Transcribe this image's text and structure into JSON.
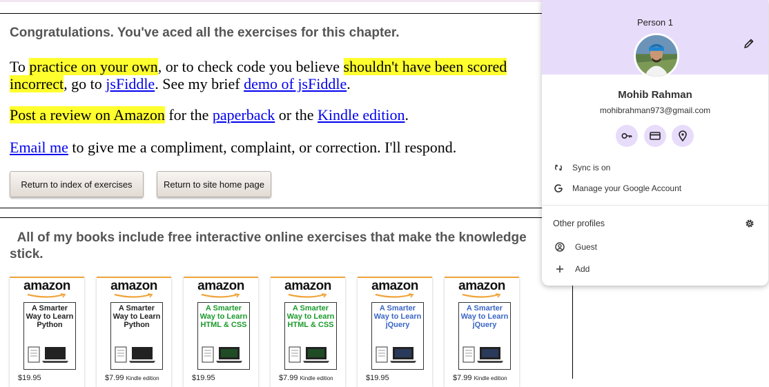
{
  "page": {
    "congrats": "Congratulations. You've aced all the exercises for this chapter.",
    "p1": {
      "t1": "To ",
      "h1": "practice on your own",
      "t2": ", or to check code you believe ",
      "h2a": "shouldn't have been scored",
      "h2b": "incorrect",
      "t3": ", go to ",
      "link_jsfiddle": "jsFiddle",
      "t4": ". See my brief ",
      "link_demo": "demo of jsFiddle",
      "t5": "."
    },
    "p2": {
      "h1": "Post a review on Amazon",
      "t1": " for the ",
      "link_paperback": "paperback",
      "t2": " or the ",
      "link_kindle": "Kindle edition",
      "t3": "."
    },
    "p3": {
      "link_email": "Email me",
      "t1": " to give me a compliment, complaint, or correction. I'll respond."
    },
    "buttons": {
      "return_index": "Return to index of exercises",
      "return_home": "Return to site home page"
    },
    "books_heading": "All of my books include free interactive online exercises that make the knowledge stick.",
    "books": [
      {
        "brand": "amazon",
        "title": "A Smarter Way to Learn Python",
        "price": "$19.95",
        "edition": "",
        "accent": "#222222"
      },
      {
        "brand": "amazon",
        "title": "A Smarter Way to Learn Python",
        "price": "$7.99",
        "edition": "Kindle edition",
        "accent": "#222222"
      },
      {
        "brand": "amazon",
        "title": "A Smarter Way to Learn HTML & CSS",
        "price": "$19.95",
        "edition": "",
        "accent": "#1a9a2a"
      },
      {
        "brand": "amazon",
        "title": "A Smarter Way to Learn HTML & CSS",
        "price": "$7.99",
        "edition": "Kindle edition",
        "accent": "#1a9a2a"
      },
      {
        "brand": "amazon",
        "title": "A Smarter Way to Learn jQuery",
        "price": "$19.95",
        "edition": "",
        "accent": "#3a66c4"
      },
      {
        "brand": "amazon",
        "title": "A Smarter Way to Learn jQuery",
        "price": "$7.99",
        "edition": "Kindle edition",
        "accent": "#3a66c4"
      }
    ]
  },
  "profile": {
    "profile_name": "Person 1",
    "user_name": "Mohib Rahman",
    "email": "mohibrahman973@gmail.com",
    "quick_actions": [
      "key-icon",
      "card-icon",
      "location-pin-icon"
    ],
    "sync": "Sync is on",
    "manage": "Manage your Google Account",
    "other_profiles": "Other profiles",
    "guest": "Guest",
    "add": "Add",
    "header_color": "#e8dcfb"
  }
}
